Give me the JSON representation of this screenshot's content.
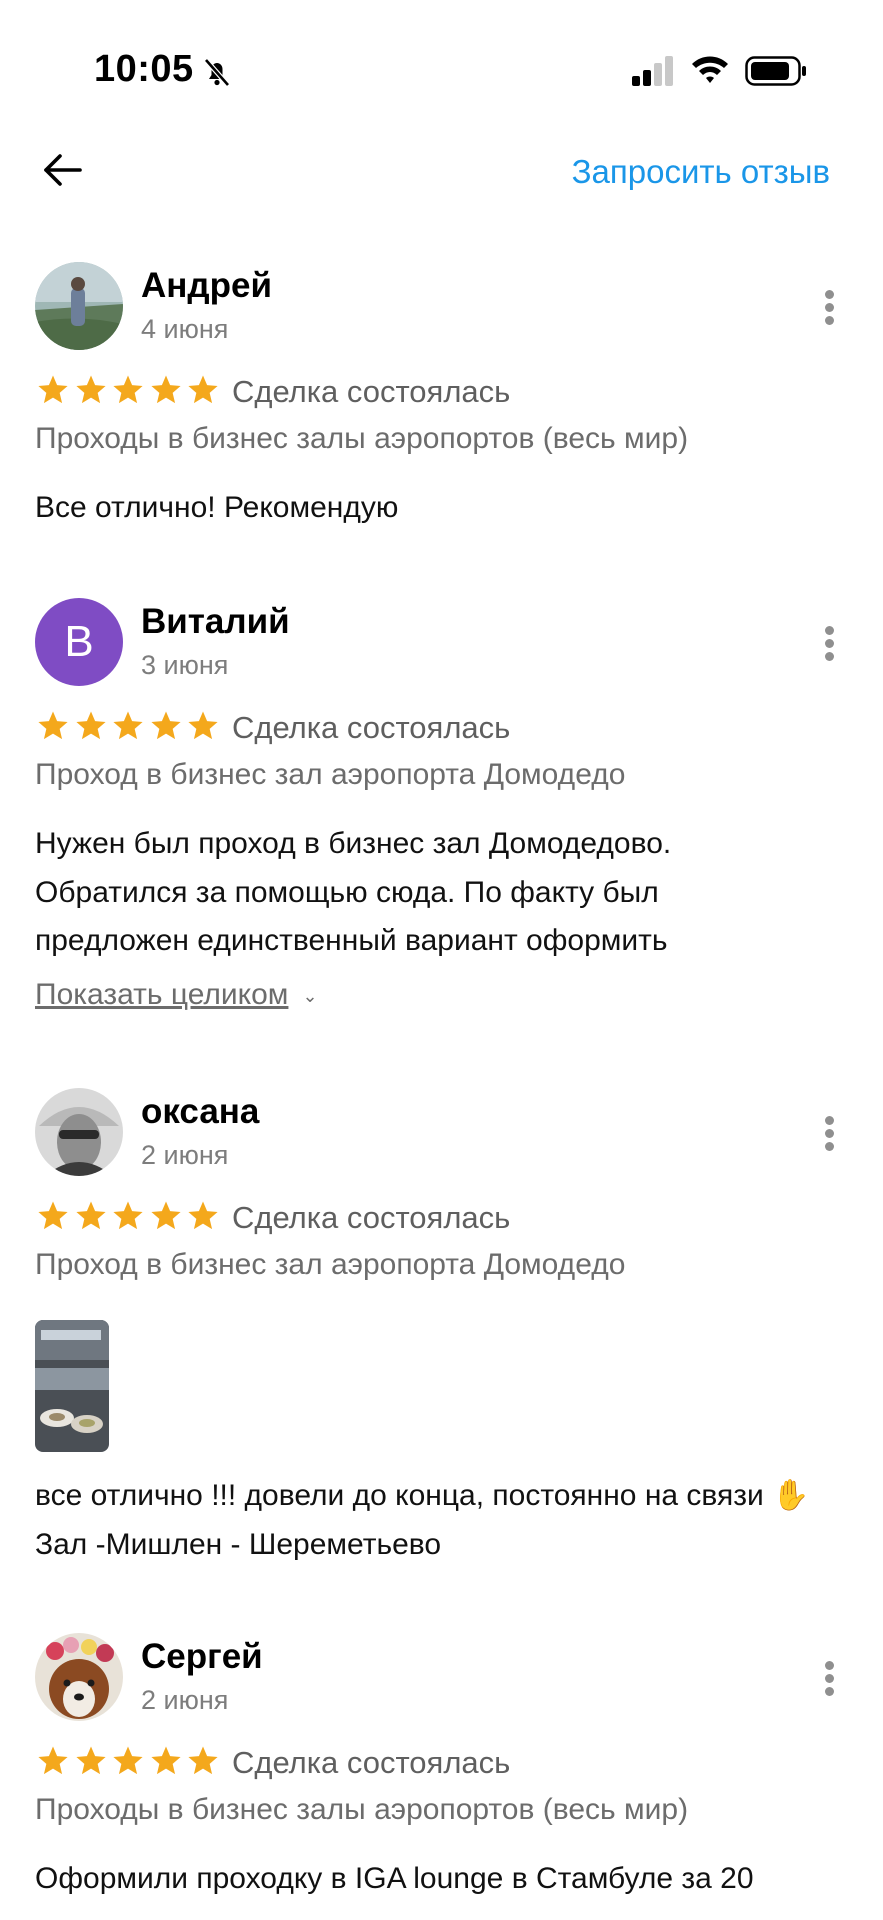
{
  "status_bar": {
    "time": "10:05",
    "icons": [
      "bell-off-icon",
      "signal-icon",
      "wifi-icon",
      "battery-icon"
    ]
  },
  "header": {
    "back_icon": "arrow-left-icon",
    "request_review_label": "Запросить отзыв"
  },
  "colors": {
    "accent": "#1a96e8",
    "star": "#f4a81c",
    "avatar_letter_bg": "#7f4cc4"
  },
  "reviews": [
    {
      "author": "Андрей",
      "date": "4 июня",
      "rating": 5,
      "deal_status": "Сделка состоялась",
      "item": "Проходы в бизнес залы аэропортов (весь мир)",
      "text": "Все отлично! Рекомендую"
    },
    {
      "author": "Виталий",
      "avatar_letter": "В",
      "date": "3 июня",
      "rating": 5,
      "deal_status": "Сделка состоялась",
      "item": "Проход в бизнес зал аэропорта Домодедо",
      "text": "Нужен был проход в бизнес зал Домодедово. Обратился за помощью сюда. По факту был предложен единственный вариант оформить",
      "show_more_label": "Показать целиком"
    },
    {
      "author": "оксана",
      "date": "2 июня",
      "rating": 5,
      "deal_status": "Сделка состоялась",
      "item": "Проход в бизнес зал аэропорта Домодедо",
      "text": "все отлично !!! довели до конца, постоянно на связи ✋Зал -Мишлен - Шереметьево"
    },
    {
      "author": "Сергей",
      "date": "2 июня",
      "rating": 5,
      "deal_status": "Сделка состоялась",
      "item": "Проходы в бизнес залы аэропортов (весь мир)",
      "text": "Оформили проходку в IGA lounge в Стамбуле за 20"
    }
  ]
}
